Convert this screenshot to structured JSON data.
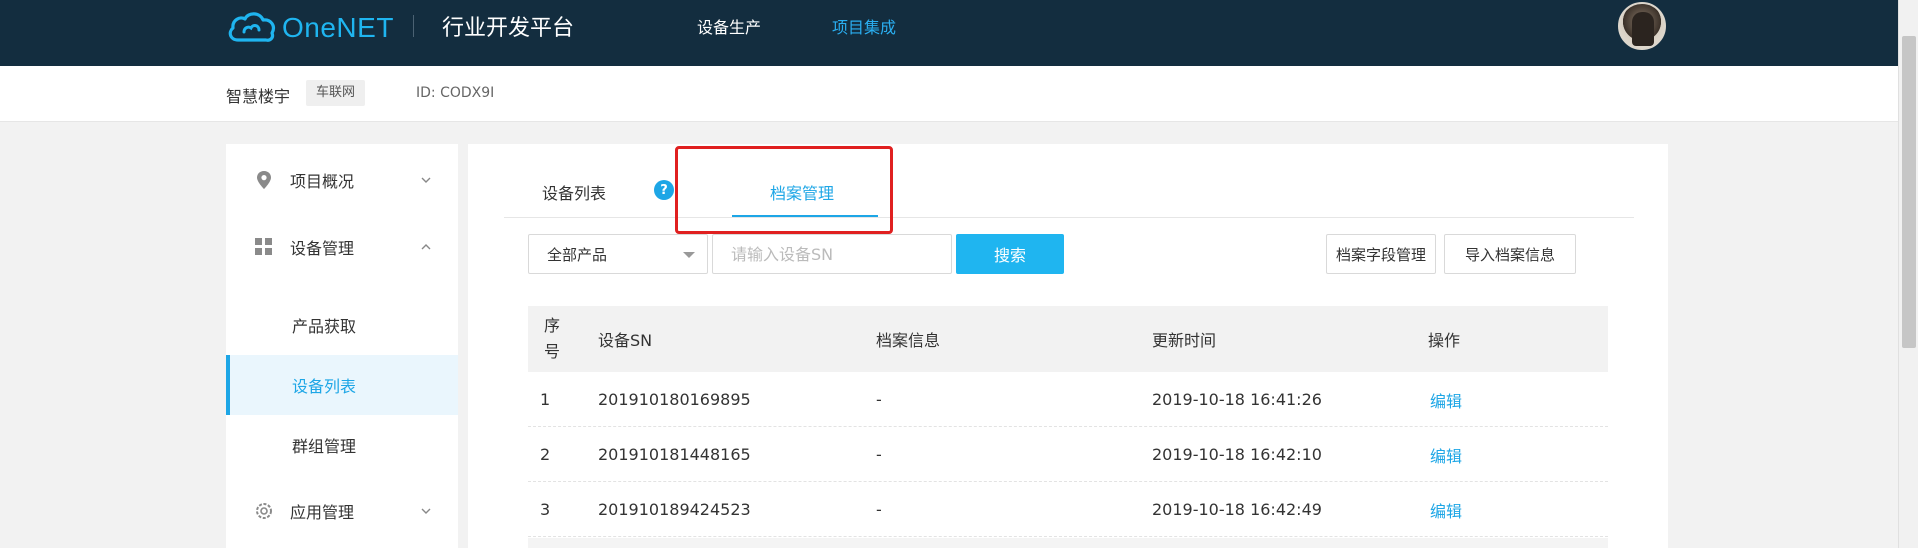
{
  "header": {
    "brand": "OneNET",
    "platform_title": "行业开发平台",
    "nav": [
      "设备生产",
      "项目集成"
    ],
    "active_nav": "项目集成",
    "colors": {
      "topbar": "#132d3f",
      "accent": "#1fb5f0"
    }
  },
  "project": {
    "name": "智慧楼宇",
    "tag": "车联网",
    "id_text": "ID: CODX9I"
  },
  "sidebar": {
    "items": [
      {
        "label": "项目概况",
        "icon": "location-pin-icon",
        "expanded": false
      },
      {
        "label": "设备管理",
        "icon": "grid-icon",
        "expanded": true
      },
      {
        "label": "应用管理",
        "icon": "gear-icon",
        "expanded": false
      }
    ],
    "sub_items": [
      {
        "label": "产品获取",
        "active": false
      },
      {
        "label": "设备列表",
        "active": true
      },
      {
        "label": "群组管理",
        "active": false
      }
    ]
  },
  "tabs": {
    "items": [
      "设备列表",
      "档案管理"
    ],
    "active": "档案管理"
  },
  "toolbar": {
    "product_select": "全部产品",
    "search_placeholder": "请输入设备SN",
    "search_label": "搜索",
    "field_mgmt_label": "档案字段管理",
    "import_label": "导入档案信息"
  },
  "table": {
    "columns": [
      "序号",
      "设备SN",
      "档案信息",
      "更新时间",
      "操作"
    ],
    "seq_header_lines": [
      "序",
      "号"
    ],
    "rows": [
      {
        "seq": "1",
        "sn": "201910180169895",
        "info": "-",
        "updated": "2019-10-18 16:41:26",
        "action": "编辑"
      },
      {
        "seq": "2",
        "sn": "201910181448165",
        "info": "-",
        "updated": "2019-10-18 16:42:10",
        "action": "编辑"
      },
      {
        "seq": "3",
        "sn": "201910189424523",
        "info": "-",
        "updated": "2019-10-18 16:42:49",
        "action": "编辑"
      }
    ]
  }
}
